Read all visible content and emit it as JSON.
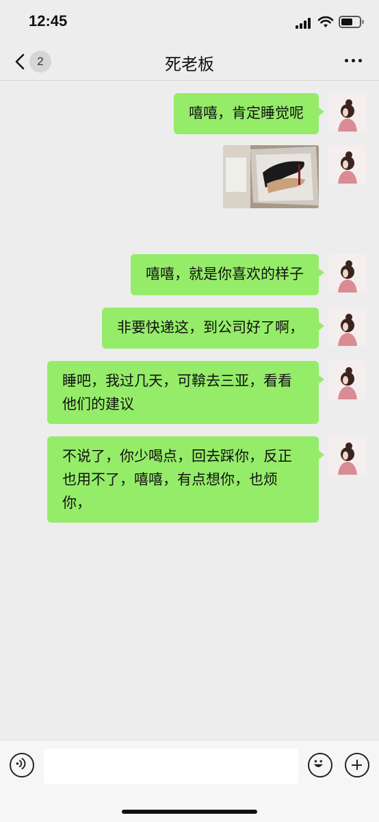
{
  "status_bar": {
    "time": "12:45"
  },
  "nav": {
    "back_badge": "2",
    "title": "死老板"
  },
  "messages": [
    {
      "type": "text",
      "text": "嘻嘻，肯定睡觉呢"
    },
    {
      "type": "image",
      "description": "shoe-box-photo"
    },
    {
      "type": "text",
      "text": "嘻嘻，就是你喜欢的样子"
    },
    {
      "type": "text",
      "text": "非要快递这，到公司好了啊，"
    },
    {
      "type": "text",
      "text": "睡吧，我过几天，可鞥去三亚，看看他们的建议"
    },
    {
      "type": "text",
      "text": "不说了，你少喝点，回去踩你，反正也用不了，嘻嘻，有点想你，也烦你，"
    }
  ],
  "colors": {
    "bubble": "#95ec69",
    "background": "#ededed"
  },
  "input_bar": {
    "placeholder": ""
  }
}
